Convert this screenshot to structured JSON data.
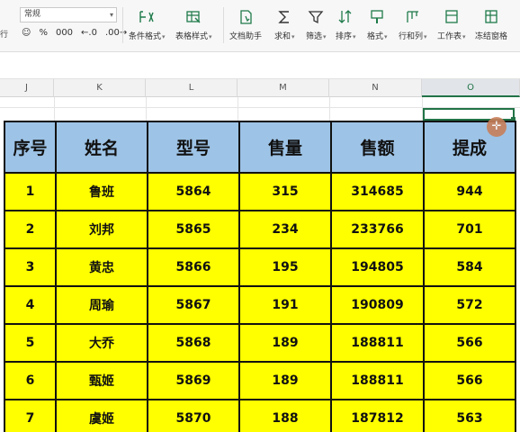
{
  "ribbon": {
    "number_format": "常规",
    "left_cut_label": "行",
    "format_buttons": [
      "☺",
      "%",
      "000",
      "←.0",
      ".00→"
    ],
    "buttons": [
      {
        "id": "conditional-format",
        "label": "条件格式",
        "icon": "conditional-format-icon"
      },
      {
        "id": "table-style",
        "label": "表格样式",
        "icon": "table-style-icon"
      },
      {
        "id": "doc-assistant",
        "label": "文档助手",
        "icon": "doc-assistant-icon"
      },
      {
        "id": "sum",
        "label": "求和",
        "icon": "sum-icon"
      },
      {
        "id": "filter",
        "label": "筛选",
        "icon": "filter-icon"
      },
      {
        "id": "sort",
        "label": "排序",
        "icon": "sort-icon"
      },
      {
        "id": "format",
        "label": "格式",
        "icon": "format-icon"
      },
      {
        "id": "rows-cols",
        "label": "行和列",
        "icon": "rows-cols-icon"
      },
      {
        "id": "worksheet",
        "label": "工作表",
        "icon": "worksheet-icon"
      },
      {
        "id": "freeze",
        "label": "冻结窗格",
        "icon": "freeze-icon"
      }
    ]
  },
  "columns": [
    "J",
    "K",
    "L",
    "M",
    "N",
    "O"
  ],
  "active_column": "O",
  "table": {
    "headers": [
      "序号",
      "姓名",
      "型号",
      "售量",
      "售额",
      "提成"
    ],
    "rows": [
      [
        "1",
        "鲁班",
        "5864",
        "315",
        "314685",
        "944"
      ],
      [
        "2",
        "刘邦",
        "5865",
        "234",
        "233766",
        "701"
      ],
      [
        "3",
        "黄忠",
        "5866",
        "195",
        "194805",
        "584"
      ],
      [
        "4",
        "周瑜",
        "5867",
        "191",
        "190809",
        "572"
      ],
      [
        "5",
        "大乔",
        "5868",
        "189",
        "188811",
        "566"
      ],
      [
        "6",
        "甄姬",
        "5869",
        "189",
        "188811",
        "566"
      ],
      [
        "7",
        "虞姬",
        "5870",
        "188",
        "187812",
        "563"
      ]
    ]
  },
  "colors": {
    "header_fill": "#9dc3e6",
    "row_fill": "#ffff00",
    "selection": "#217346",
    "cursor": "#c87f5a"
  }
}
